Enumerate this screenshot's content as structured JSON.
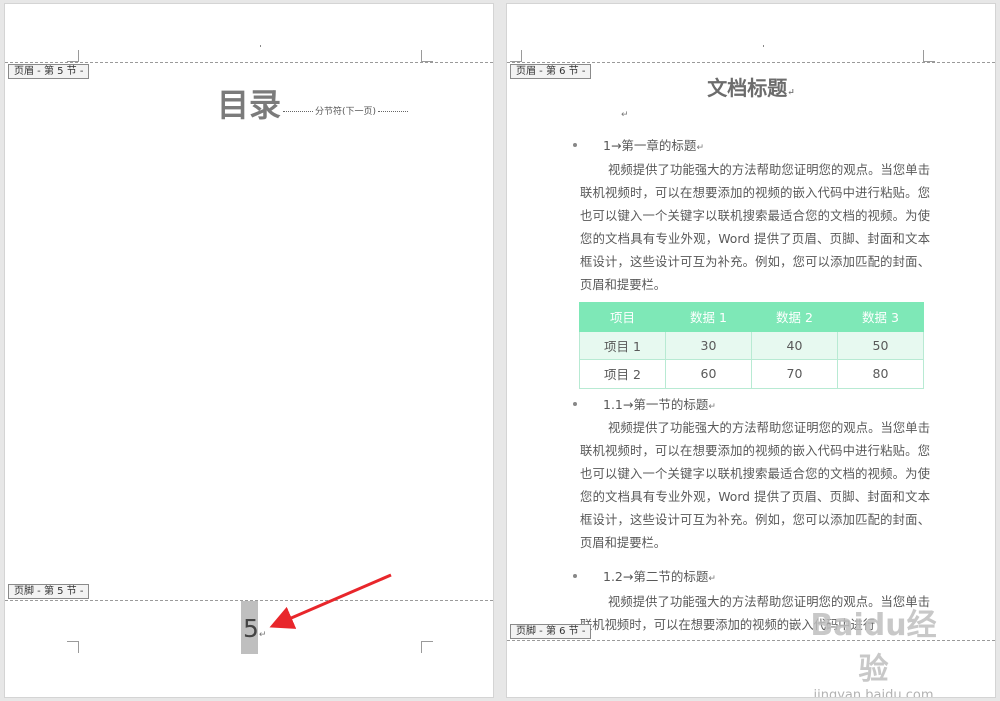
{
  "left_page": {
    "header_tab": "页眉 - 第 5 节 -",
    "footer_tab": "页脚 - 第 5 节 -",
    "toc_title": "目录",
    "section_break_label": "分节符(下一页)",
    "page_number": "5",
    "paragraph_mark": "↵"
  },
  "right_page": {
    "header_tab": "页眉 - 第 6 节 -",
    "footer_tab": "页脚 - 第 6 节 -",
    "title": "文档标题",
    "paragraph_mark": "↵",
    "headings": [
      "1→第一章的标题",
      "1.1→第一节的标题",
      "1.2→第二节的标题"
    ],
    "paragraphs": [
      "视频提供了功能强大的方法帮助您证明您的观点。当您单击联机视频时，可以在想要添加的视频的嵌入代码中进行粘贴。您也可以键入一个关键字以联机搜索最适合您的文档的视频。为使您的文档具有专业外观，Word 提供了页眉、页脚、封面和文本框设计，这些设计可互为补充。例如，您可以添加匹配的封面、页眉和提要栏。",
      "视频提供了功能强大的方法帮助您证明您的观点。当您单击联机视频时，可以在想要添加的视频的嵌入代码中进行粘贴。您也可以键入一个关键字以联机搜索最适合您的文档的视频。为使您的文档具有专业外观，Word 提供了页眉、页脚、封面和文本框设计，这些设计可互为补充。例如，您可以添加匹配的封面、页眉和提要栏。",
      "视频提供了功能强大的方法帮助您证明您的观点。当您单击联机视频时，可以在想要添加的视频的嵌入代码中进行"
    ],
    "table": {
      "headers": [
        "项目",
        "数据 1",
        "数据 2",
        "数据 3"
      ],
      "rows": [
        [
          "项目 1",
          "30",
          "40",
          "50"
        ],
        [
          "项目 2",
          "60",
          "70",
          "80"
        ]
      ]
    }
  },
  "watermark": {
    "logo": "Baidu经验",
    "url": "jingyan.baidu.com"
  },
  "colors": {
    "table_header": "#7ee8b7",
    "table_row_alt": "#e7f9f0",
    "arrow": "#e8262b",
    "page_number_highlight": "#bfbfbf"
  }
}
